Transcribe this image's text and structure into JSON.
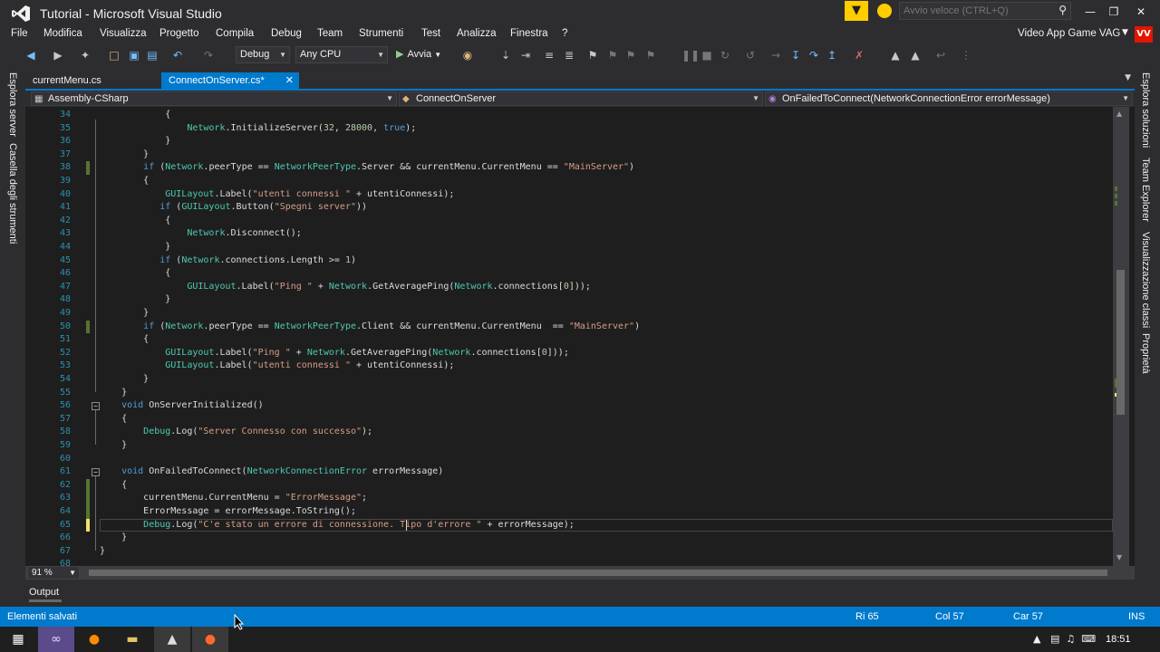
{
  "window": {
    "title": "Tutorial - Microsoft Visual Studio",
    "quick_launch_placeholder": "Avvio veloce (CTRL+Q)",
    "notification_glyph": "▼",
    "minimize_glyph": "—",
    "restore_glyph": "❐",
    "close_glyph": "✕"
  },
  "menu": {
    "items": [
      "File",
      "Modifica",
      "Visualizza",
      "Progetto",
      "Compila",
      "Debug",
      "Team",
      "Strumenti",
      "Test",
      "Analizza",
      "Finestra",
      "?"
    ],
    "account_name": "Video App Game VAG",
    "account_initials": "VV",
    "account_color": "#e51400"
  },
  "toolbar": {
    "configuration": "Debug",
    "platform": "Any CPU",
    "run_label": "Avvia"
  },
  "left_panels": [
    "Esplora server",
    "Casella degli strumenti"
  ],
  "right_panels": [
    "Esplora soluzioni",
    "Team Explorer",
    "Visualizzazione classi",
    "Proprietà"
  ],
  "tabs": [
    {
      "label": "currentMenu.cs",
      "active": false
    },
    {
      "label": "ConnectOnServer.cs*",
      "active": true
    }
  ],
  "navbar": {
    "project": "Assembly-CSharp",
    "type": "ConnectOnServer",
    "member": "OnFailedToConnect(NetworkConnectionError errorMessage)"
  },
  "editor": {
    "lines": [
      {
        "n": "34",
        "text": "            {"
      },
      {
        "n": "35",
        "text": "                Network.InitializeServer(32, 28000, true);"
      },
      {
        "n": "36",
        "text": "            }"
      },
      {
        "n": "37",
        "text": "        }"
      },
      {
        "n": "38",
        "text": "        if (Network.peerType == NetworkPeerType.Server && currentMenu.CurrentMenu == \"MainServer\")"
      },
      {
        "n": "39",
        "text": "        {"
      },
      {
        "n": "40",
        "text": "            GUILayout.Label(\"utenti connessi \" + utentiConnessi);"
      },
      {
        "n": "41",
        "text": "           if (GUILayout.Button(\"Spegni server\"))"
      },
      {
        "n": "42",
        "text": "            {"
      },
      {
        "n": "43",
        "text": "                Network.Disconnect();"
      },
      {
        "n": "44",
        "text": "            }"
      },
      {
        "n": "45",
        "text": "           if (Network.connections.Length >= 1)"
      },
      {
        "n": "46",
        "text": "            {"
      },
      {
        "n": "47",
        "text": "                GUILayout.Label(\"Ping \" + Network.GetAveragePing(Network.connections[0]));"
      },
      {
        "n": "48",
        "text": "            }"
      },
      {
        "n": "49",
        "text": "        }"
      },
      {
        "n": "50",
        "text": "        if (Network.peerType == NetworkPeerType.Client && currentMenu.CurrentMenu  == \"MainServer\")"
      },
      {
        "n": "51",
        "text": "        {"
      },
      {
        "n": "52",
        "text": "            GUILayout.Label(\"Ping \" + Network.GetAveragePing(Network.connections[0]));"
      },
      {
        "n": "53",
        "text": "            GUILayout.Label(\"utenti connessi \" + utentiConnessi);"
      },
      {
        "n": "54",
        "text": "        }"
      },
      {
        "n": "55",
        "text": "    }"
      },
      {
        "n": "56",
        "text": "    void OnServerInitialized()"
      },
      {
        "n": "57",
        "text": "    {"
      },
      {
        "n": "58",
        "text": "        Debug.Log(\"Server Connesso con successo\");"
      },
      {
        "n": "59",
        "text": "    }"
      },
      {
        "n": "60",
        "text": ""
      },
      {
        "n": "61",
        "text": "    void OnFailedToConnect(NetworkConnectionError errorMessage)"
      },
      {
        "n": "62",
        "text": "    {"
      },
      {
        "n": "63",
        "text": "        currentMenu.CurrentMenu = \"ErrorMessage\";"
      },
      {
        "n": "64",
        "text": "        ErrorMessage = errorMessage.ToString();"
      },
      {
        "n": "65",
        "text": "        Debug.Log(\"C'e stato un errore di connessione. Tipo d'errore \" + errorMessage);"
      },
      {
        "n": "66",
        "text": "    }"
      },
      {
        "n": "67",
        "text": "}"
      },
      {
        "n": "68",
        "text": ""
      }
    ],
    "zoom": "91 %"
  },
  "output_tab": "Output",
  "status": {
    "message": "Elementi salvati",
    "line": "Ri 65",
    "column": "Col 57",
    "char": "Car 57",
    "mode": "INS"
  },
  "taskbar": {
    "clock": "18:51"
  }
}
